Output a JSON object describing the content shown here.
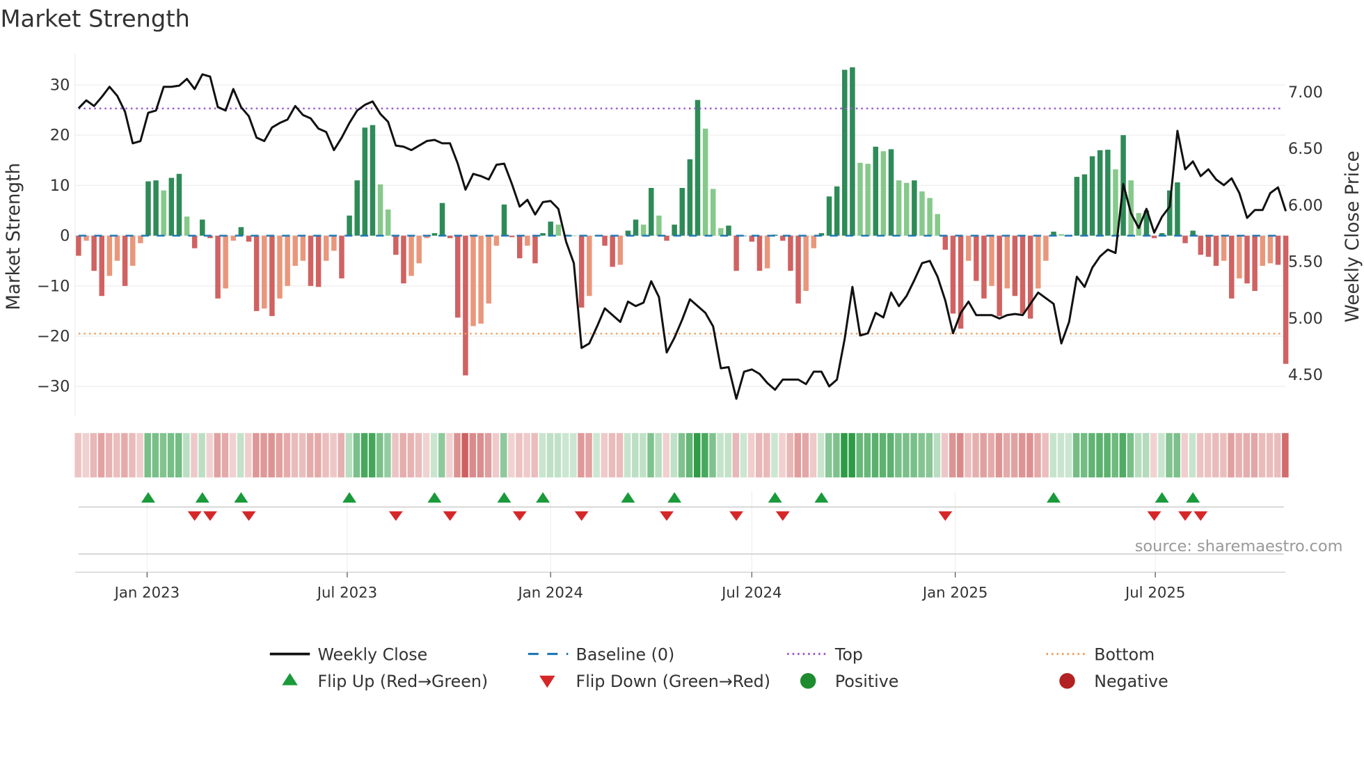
{
  "chart_data": {
    "type": "bar",
    "title": "Market Strength",
    "ylabel": "Market Strength",
    "y2label": "Weekly Close Price",
    "ylim": [
      -36,
      37
    ],
    "y2lim": [
      4.2,
      7.25
    ],
    "yticks": [
      "30",
      "20",
      "10",
      "0",
      "−10",
      "−20",
      "−30"
    ],
    "ytick_values": [
      30,
      20,
      10,
      0,
      -10,
      -20,
      -30
    ],
    "y2ticks": [
      "7.00",
      "6.50",
      "6.00",
      "5.50",
      "5.00",
      "4.50"
    ],
    "y2tick_values": [
      7.0,
      6.5,
      6.0,
      5.5,
      5.0,
      4.5
    ],
    "x_start_week": "2022-10-31",
    "x_interval_days": 7,
    "xticks": [
      {
        "label": "Jan 2023",
        "date": "2023-01-01"
      },
      {
        "label": "Jul 2023",
        "date": "2023-07-01"
      },
      {
        "label": "Jan 2024",
        "date": "2024-01-01"
      },
      {
        "label": "Jul 2024",
        "date": "2024-07-01"
      },
      {
        "label": "Jan 2025",
        "date": "2025-01-01"
      },
      {
        "label": "Jul 2025",
        "date": "2025-07-01"
      }
    ],
    "top_level": 25.3,
    "bottom_level": -19.5,
    "strength": [
      -4,
      -1,
      -7,
      -12,
      -8,
      -5,
      -10,
      -6,
      -1.5,
      10.8,
      11,
      9,
      11.5,
      12.3,
      3.8,
      -2.5,
      3.2,
      -0.5,
      -12.5,
      -10.5,
      -1,
      1.7,
      -1.2,
      -15,
      -14.5,
      -16,
      -12.5,
      -10,
      -6,
      -5,
      -10,
      -10.2,
      -5,
      -3,
      -8.5,
      4,
      11,
      21.5,
      22,
      10.2,
      5.2,
      -3.8,
      -9.5,
      -8,
      -5.5,
      -0.5,
      0.5,
      6.5,
      -0.5,
      -16.3,
      -27.8,
      -18,
      -17.5,
      -13.5,
      -2,
      6.2,
      -0.3,
      -4.5,
      -2,
      -5.5,
      0.5,
      2.8,
      2.2,
      0.2,
      0,
      -14.3,
      -12,
      0,
      -2,
      -6.2,
      -5.8,
      1,
      3.2,
      2.2,
      9.5,
      4,
      -1,
      2.2,
      9.5,
      15.2,
      27,
      21.3,
      9.3,
      1.5,
      2,
      -7,
      0,
      -1.2,
      -7,
      -6.5,
      0.2,
      -1,
      -7,
      -13.5,
      -11,
      -2.5,
      0.5,
      7.8,
      9.8,
      33,
      33.5,
      14.5,
      14.3,
      17.7,
      16.8,
      17.2,
      11,
      10.5,
      11,
      8.8,
      7.5,
      4.3,
      -2.8,
      -15.5,
      -18.5,
      -5,
      -9,
      -12.5,
      -10,
      -16,
      -10.5,
      -12,
      -15.5,
      -16.5,
      -10.5,
      -5,
      0.8,
      0.3,
      0,
      11.7,
      12.2,
      15.8,
      17,
      17.1,
      13.2,
      20,
      11,
      4.5,
      5,
      -0.5,
      0.5,
      9,
      10.6,
      -1.5,
      1,
      -3.8,
      -4.2,
      -6,
      -5,
      -12.5,
      -8.5,
      -9.5,
      -11,
      -6,
      -5.5,
      -5.8,
      -25.5
    ],
    "weekly_close": [
      6.85,
      6.92,
      6.87,
      6.95,
      7.04,
      6.96,
      6.82,
      6.54,
      6.56,
      6.81,
      6.83,
      7.04,
      7.04,
      7.05,
      7.11,
      7.02,
      7.15,
      7.13,
      6.86,
      6.83,
      7.02,
      6.86,
      6.78,
      6.59,
      6.56,
      6.68,
      6.72,
      6.75,
      6.87,
      6.79,
      6.76,
      6.67,
      6.64,
      6.48,
      6.59,
      6.72,
      6.83,
      6.88,
      6.91,
      6.8,
      6.73,
      6.52,
      6.51,
      6.48,
      6.52,
      6.56,
      6.57,
      6.54,
      6.54,
      6.36,
      6.13,
      6.27,
      6.25,
      6.22,
      6.35,
      6.36,
      6.18,
      5.98,
      6.04,
      5.91,
      6.02,
      6.03,
      5.96,
      5.67,
      5.48,
      4.73,
      4.77,
      4.92,
      5.08,
      5.02,
      4.96,
      5.14,
      5.1,
      5.13,
      5.32,
      5.18,
      4.69,
      4.82,
      4.98,
      5.16,
      5.1,
      5.04,
      4.92,
      4.55,
      4.56,
      4.28,
      4.52,
      4.54,
      4.5,
      4.42,
      4.36,
      4.45,
      4.45,
      4.45,
      4.41,
      4.52,
      4.52,
      4.39,
      4.45,
      4.81,
      5.27,
      4.84,
      4.86,
      5.04,
      5.0,
      5.22,
      5.1,
      5.19,
      5.33,
      5.48,
      5.5,
      5.36,
      5.15,
      4.86,
      5.04,
      5.14,
      5.02,
      5.02,
      5.02,
      4.99,
      5.02,
      5.03,
      5.02,
      5.12,
      5.22,
      5.17,
      5.12,
      4.77,
      4.96,
      5.36,
      5.27,
      5.44,
      5.54,
      5.6,
      5.57,
      6.18,
      5.92,
      5.79,
      5.96,
      5.75,
      5.89,
      5.98,
      6.65,
      6.31,
      6.38,
      6.25,
      6.31,
      6.22,
      6.17,
      6.23,
      6.1,
      5.88,
      5.95,
      5.95,
      6.1,
      6.15,
      5.94
    ],
    "flip_up_weeks": [
      9,
      16,
      21,
      35,
      46,
      55,
      60,
      71,
      77,
      90,
      96,
      126,
      140,
      144
    ],
    "flip_down_weeks": [
      15,
      17,
      22,
      41,
      48,
      57,
      65,
      76,
      85,
      91,
      112,
      139,
      143,
      145
    ],
    "legend": [
      {
        "label": "Weekly Close",
        "kind": "solid",
        "color": "#111111"
      },
      {
        "label": "Baseline (0)",
        "kind": "dash",
        "color": "#1f77b4"
      },
      {
        "label": "Top",
        "kind": "dot",
        "color": "#9b59d0"
      },
      {
        "label": "Bottom",
        "kind": "dot",
        "color": "#f0a060"
      },
      {
        "label": "Flip Up (Red→Green)",
        "kind": "up",
        "color": "#1a9a3a"
      },
      {
        "label": "Flip Down (Green→Red)",
        "kind": "down",
        "color": "#d62728"
      },
      {
        "label": "Positive",
        "kind": "circle",
        "color": "#1e8c2e"
      },
      {
        "label": "Negative",
        "kind": "circle",
        "color": "#b22222"
      }
    ],
    "legend_placement": "bottom",
    "source": "source: sharemaestro.com"
  },
  "colors": {
    "pos_strong": "#2e8b57",
    "pos_weak": "#86c98a",
    "neg_strong": "#d06262",
    "neg_weak": "#e9977c"
  }
}
